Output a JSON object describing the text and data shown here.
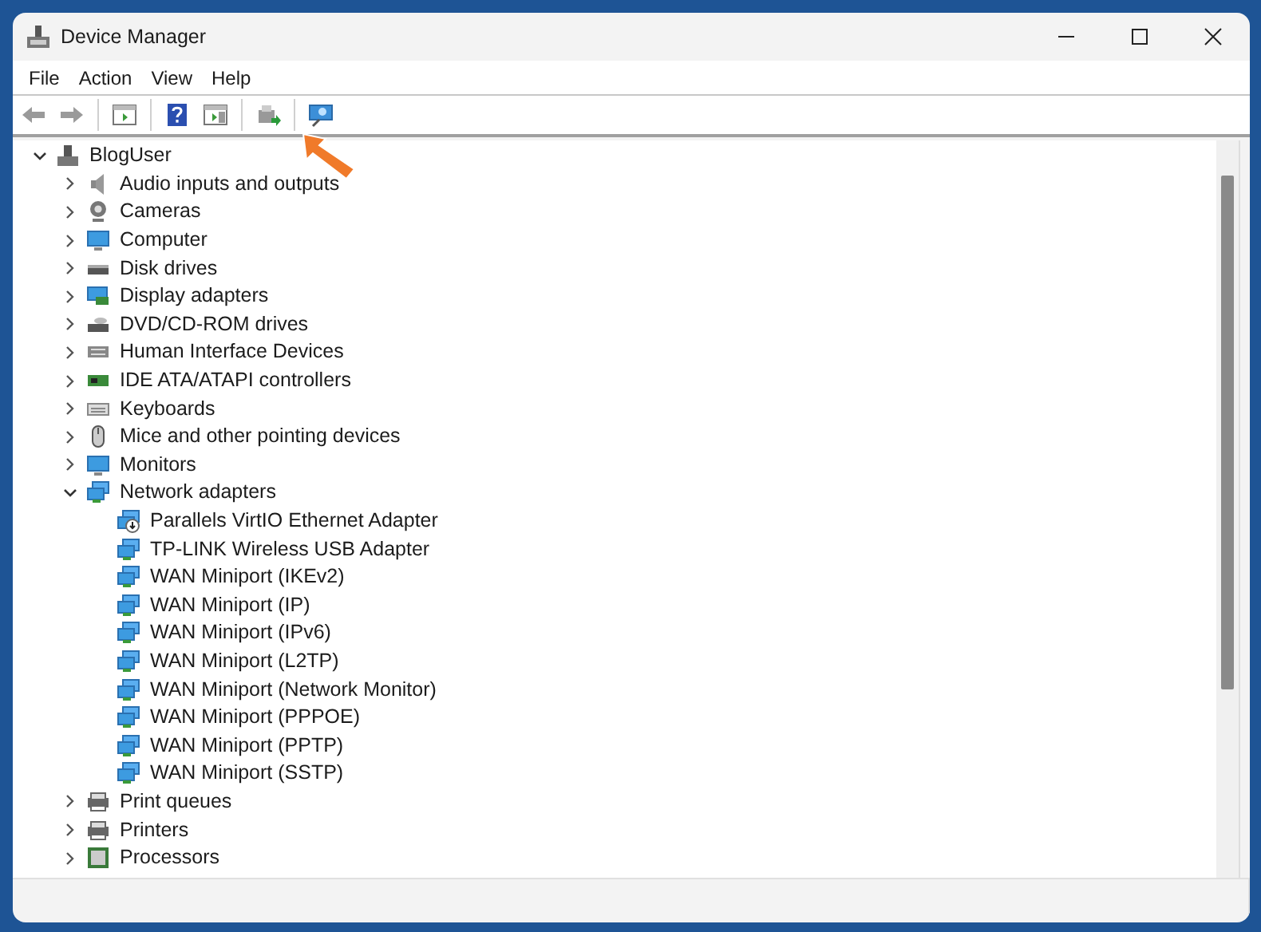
{
  "window": {
    "title": "Device Manager"
  },
  "menu": [
    {
      "label": "File"
    },
    {
      "label": "Action"
    },
    {
      "label": "View"
    },
    {
      "label": "Help"
    }
  ],
  "toolbar": [
    {
      "kind": "back",
      "disabled": true
    },
    {
      "kind": "forward",
      "disabled": true
    },
    {
      "kind": "sep"
    },
    {
      "kind": "console-tree",
      "disabled": false
    },
    {
      "kind": "sep"
    },
    {
      "kind": "help",
      "disabled": false
    },
    {
      "kind": "action-pane",
      "disabled": false
    },
    {
      "kind": "sep"
    },
    {
      "kind": "update-driver",
      "disabled": false
    },
    {
      "kind": "sep"
    },
    {
      "kind": "scan",
      "disabled": false
    }
  ],
  "tree": {
    "label": "BlogUser",
    "kind": "root",
    "expanded": true,
    "children": [
      {
        "label": "Audio inputs and outputs",
        "kind": "audio",
        "expanded": false
      },
      {
        "label": "Cameras",
        "kind": "camera",
        "expanded": false
      },
      {
        "label": "Computer",
        "kind": "computer",
        "expanded": false
      },
      {
        "label": "Disk drives",
        "kind": "disk",
        "expanded": false
      },
      {
        "label": "Display adapters",
        "kind": "display",
        "expanded": false
      },
      {
        "label": "DVD/CD-ROM drives",
        "kind": "dvd",
        "expanded": false
      },
      {
        "label": "Human Interface Devices",
        "kind": "hid",
        "expanded": false
      },
      {
        "label": "IDE ATA/ATAPI controllers",
        "kind": "ide",
        "expanded": false
      },
      {
        "label": "Keyboards",
        "kind": "keyboard",
        "expanded": false
      },
      {
        "label": "Mice and other pointing devices",
        "kind": "mouse",
        "expanded": false
      },
      {
        "label": "Monitors",
        "kind": "monitor",
        "expanded": false
      },
      {
        "label": "Network adapters",
        "kind": "network",
        "expanded": true,
        "children": [
          {
            "label": "Parallels VirtIO Ethernet Adapter",
            "kind": "network-warning"
          },
          {
            "label": "TP-LINK Wireless USB Adapter",
            "kind": "network"
          },
          {
            "label": "WAN Miniport (IKEv2)",
            "kind": "network"
          },
          {
            "label": "WAN Miniport (IP)",
            "kind": "network"
          },
          {
            "label": "WAN Miniport (IPv6)",
            "kind": "network"
          },
          {
            "label": "WAN Miniport (L2TP)",
            "kind": "network"
          },
          {
            "label": "WAN Miniport (Network Monitor)",
            "kind": "network"
          },
          {
            "label": "WAN Miniport (PPPOE)",
            "kind": "network"
          },
          {
            "label": "WAN Miniport (PPTP)",
            "kind": "network"
          },
          {
            "label": "WAN Miniport (SSTP)",
            "kind": "network"
          }
        ]
      },
      {
        "label": "Print queues",
        "kind": "printer",
        "expanded": false
      },
      {
        "label": "Printers",
        "kind": "printer",
        "expanded": false
      },
      {
        "label": "Processors",
        "kind": "processor",
        "expanded": false
      }
    ]
  }
}
